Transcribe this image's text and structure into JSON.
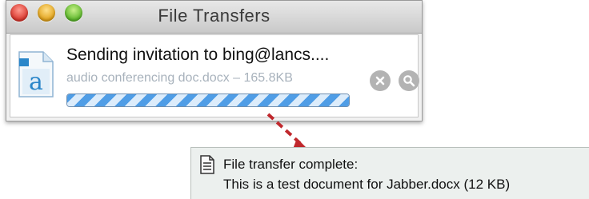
{
  "window": {
    "title": "File Transfers"
  },
  "transfer": {
    "title": "Sending invitation to bing@lancs....",
    "file_info": "audio conferencing doc.docx – 165.8KB",
    "progress": 1.0,
    "file_icon_letter": "a"
  },
  "notification": {
    "title": "File transfer complete:",
    "body": "This is a test document for Jabber.docx (12 KB)"
  },
  "colors": {
    "arrow": "#c0282d",
    "progress_stripe": "#4f9de6",
    "file_icon_accent": "#2a86c9"
  },
  "icons": {
    "close": "close-icon",
    "minimize": "minimize-icon",
    "maximize": "maximize-icon",
    "cancel": "cancel-x-icon",
    "reveal": "magnifier-icon",
    "document": "document-icon",
    "notification": "document-list-icon"
  }
}
